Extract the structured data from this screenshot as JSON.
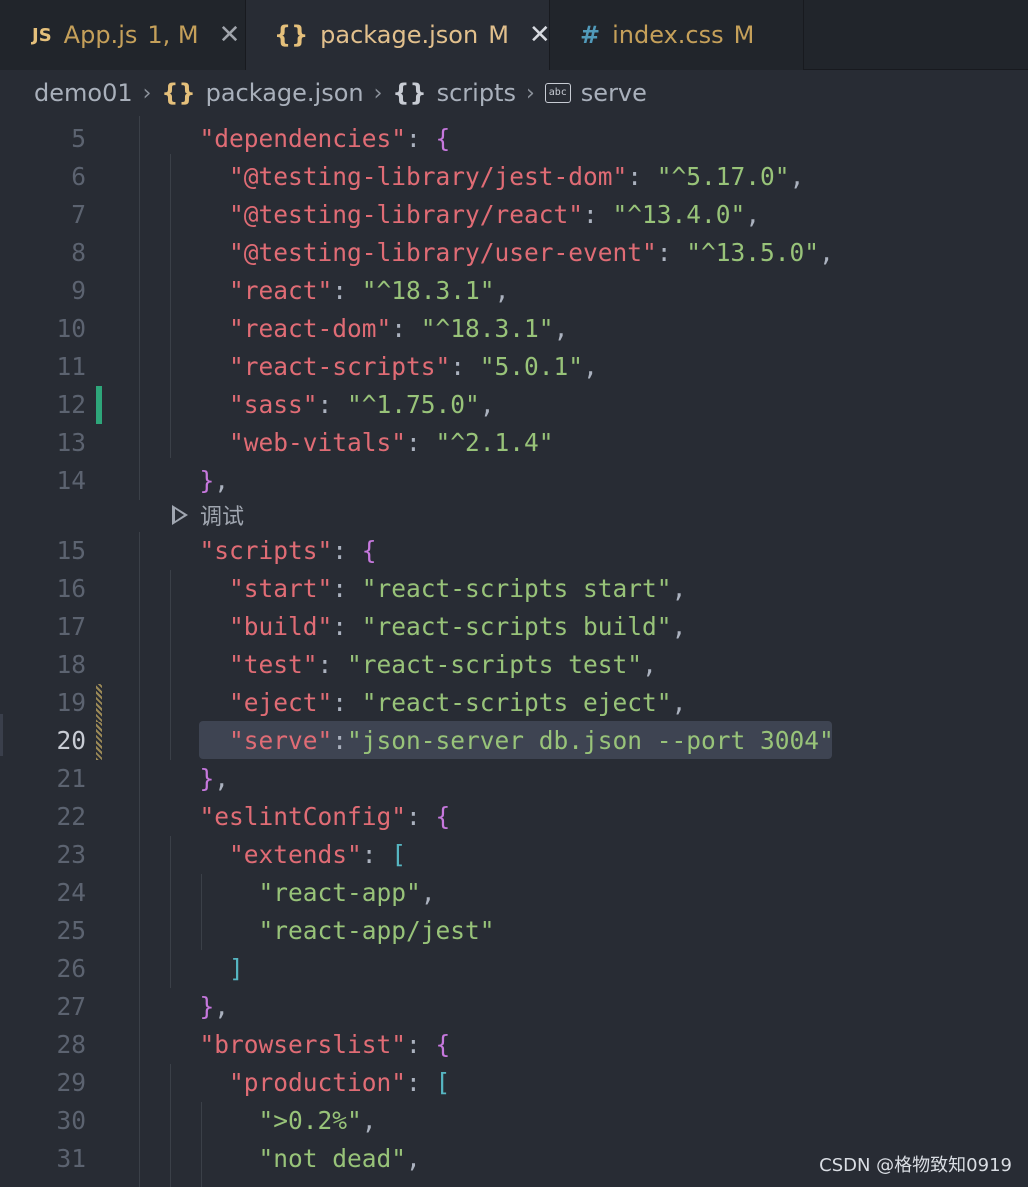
{
  "tabs": [
    {
      "icon": "JS",
      "label": "App.js",
      "badge": "1, M",
      "active": false
    },
    {
      "icon": "{}",
      "label": "package.json",
      "badge": "M",
      "active": true,
      "close": "✕"
    },
    {
      "icon": "#",
      "label": "index.css",
      "badge": "M",
      "active": false
    }
  ],
  "tab_close_inactive": "✕",
  "breadcrumb": {
    "folder": "demo01",
    "file_icon": "{}",
    "file": "package.json",
    "section_icon": "{}",
    "section": "scripts",
    "key": "serve"
  },
  "codelens": {
    "label": "调试"
  },
  "lines": [
    {
      "n": "5",
      "tokens": [
        {
          "t": "  ",
          "c": "p"
        },
        {
          "t": "\"dependencies\"",
          "c": "k"
        },
        {
          "t": ": ",
          "c": "p"
        },
        {
          "t": "{",
          "c": "bm"
        }
      ]
    },
    {
      "n": "6",
      "tokens": [
        {
          "t": "    ",
          "c": "p"
        },
        {
          "t": "\"@testing-library/jest-dom\"",
          "c": "k"
        },
        {
          "t": ": ",
          "c": "p"
        },
        {
          "t": "\"^5.17.0\"",
          "c": "s"
        },
        {
          "t": ",",
          "c": "p"
        }
      ]
    },
    {
      "n": "7",
      "tokens": [
        {
          "t": "    ",
          "c": "p"
        },
        {
          "t": "\"@testing-library/react\"",
          "c": "k"
        },
        {
          "t": ": ",
          "c": "p"
        },
        {
          "t": "\"^13.4.0\"",
          "c": "s"
        },
        {
          "t": ",",
          "c": "p"
        }
      ]
    },
    {
      "n": "8",
      "tokens": [
        {
          "t": "    ",
          "c": "p"
        },
        {
          "t": "\"@testing-library/user-event\"",
          "c": "k"
        },
        {
          "t": ": ",
          "c": "p"
        },
        {
          "t": "\"^13.5.0\"",
          "c": "s"
        },
        {
          "t": ",",
          "c": "p"
        }
      ]
    },
    {
      "n": "9",
      "tokens": [
        {
          "t": "    ",
          "c": "p"
        },
        {
          "t": "\"react\"",
          "c": "k"
        },
        {
          "t": ": ",
          "c": "p"
        },
        {
          "t": "\"^18.3.1\"",
          "c": "s"
        },
        {
          "t": ",",
          "c": "p"
        }
      ]
    },
    {
      "n": "10",
      "tokens": [
        {
          "t": "    ",
          "c": "p"
        },
        {
          "t": "\"react-dom\"",
          "c": "k"
        },
        {
          "t": ": ",
          "c": "p"
        },
        {
          "t": "\"^18.3.1\"",
          "c": "s"
        },
        {
          "t": ",",
          "c": "p"
        }
      ]
    },
    {
      "n": "11",
      "tokens": [
        {
          "t": "    ",
          "c": "p"
        },
        {
          "t": "\"react-scripts\"",
          "c": "k"
        },
        {
          "t": ": ",
          "c": "p"
        },
        {
          "t": "\"5.0.1\"",
          "c": "s"
        },
        {
          "t": ",",
          "c": "p"
        }
      ]
    },
    {
      "n": "12",
      "tokens": [
        {
          "t": "    ",
          "c": "p"
        },
        {
          "t": "\"sass\"",
          "c": "k"
        },
        {
          "t": ": ",
          "c": "p"
        },
        {
          "t": "\"^1.75.0\"",
          "c": "s"
        },
        {
          "t": ",",
          "c": "p"
        }
      ],
      "gutter": "added"
    },
    {
      "n": "13",
      "tokens": [
        {
          "t": "    ",
          "c": "p"
        },
        {
          "t": "\"web-vitals\"",
          "c": "k"
        },
        {
          "t": ": ",
          "c": "p"
        },
        {
          "t": "\"^2.1.4\"",
          "c": "s"
        }
      ]
    },
    {
      "n": "14",
      "tokens": [
        {
          "t": "  ",
          "c": "p"
        },
        {
          "t": "}",
          "c": "bm"
        },
        {
          "t": ",",
          "c": "p"
        }
      ]
    },
    {
      "n": "15",
      "tokens": [
        {
          "t": "  ",
          "c": "p"
        },
        {
          "t": "\"scripts\"",
          "c": "k"
        },
        {
          "t": ": ",
          "c": "p"
        },
        {
          "t": "{",
          "c": "bm"
        }
      ]
    },
    {
      "n": "16",
      "tokens": [
        {
          "t": "    ",
          "c": "p"
        },
        {
          "t": "\"start\"",
          "c": "k"
        },
        {
          "t": ": ",
          "c": "p"
        },
        {
          "t": "\"react-scripts start\"",
          "c": "s"
        },
        {
          "t": ",",
          "c": "p"
        }
      ]
    },
    {
      "n": "17",
      "tokens": [
        {
          "t": "    ",
          "c": "p"
        },
        {
          "t": "\"build\"",
          "c": "k"
        },
        {
          "t": ": ",
          "c": "p"
        },
        {
          "t": "\"react-scripts build\"",
          "c": "s"
        },
        {
          "t": ",",
          "c": "p"
        }
      ]
    },
    {
      "n": "18",
      "tokens": [
        {
          "t": "    ",
          "c": "p"
        },
        {
          "t": "\"test\"",
          "c": "k"
        },
        {
          "t": ": ",
          "c": "p"
        },
        {
          "t": "\"react-scripts test\"",
          "c": "s"
        },
        {
          "t": ",",
          "c": "p"
        }
      ]
    },
    {
      "n": "19",
      "tokens": [
        {
          "t": "    ",
          "c": "p"
        },
        {
          "t": "\"eject\"",
          "c": "k"
        },
        {
          "t": ": ",
          "c": "p"
        },
        {
          "t": "\"react-scripts eject\"",
          "c": "s"
        },
        {
          "t": ",",
          "c": "p"
        }
      ],
      "gutter": "modified"
    },
    {
      "n": "20",
      "tokens": [
        {
          "t": "    ",
          "c": "p"
        },
        {
          "t": "\"serve\"",
          "c": "k"
        },
        {
          "t": ":",
          "c": "p"
        },
        {
          "t": "\"json-server db.json --port 3004\"",
          "c": "s"
        }
      ],
      "gutter": "modified",
      "current": true
    },
    {
      "n": "21",
      "tokens": [
        {
          "t": "  ",
          "c": "p"
        },
        {
          "t": "}",
          "c": "bm"
        },
        {
          "t": ",",
          "c": "p"
        }
      ]
    },
    {
      "n": "22",
      "tokens": [
        {
          "t": "  ",
          "c": "p"
        },
        {
          "t": "\"eslintConfig\"",
          "c": "k"
        },
        {
          "t": ": ",
          "c": "p"
        },
        {
          "t": "{",
          "c": "bm"
        }
      ]
    },
    {
      "n": "23",
      "tokens": [
        {
          "t": "    ",
          "c": "p"
        },
        {
          "t": "\"extends\"",
          "c": "k"
        },
        {
          "t": ": ",
          "c": "p"
        },
        {
          "t": "[",
          "c": "bb"
        }
      ]
    },
    {
      "n": "24",
      "tokens": [
        {
          "t": "      ",
          "c": "p"
        },
        {
          "t": "\"react-app\"",
          "c": "s"
        },
        {
          "t": ",",
          "c": "p"
        }
      ]
    },
    {
      "n": "25",
      "tokens": [
        {
          "t": "      ",
          "c": "p"
        },
        {
          "t": "\"react-app/jest\"",
          "c": "s"
        }
      ]
    },
    {
      "n": "26",
      "tokens": [
        {
          "t": "    ",
          "c": "p"
        },
        {
          "t": "]",
          "c": "bb"
        }
      ]
    },
    {
      "n": "27",
      "tokens": [
        {
          "t": "  ",
          "c": "p"
        },
        {
          "t": "}",
          "c": "bm"
        },
        {
          "t": ",",
          "c": "p"
        }
      ]
    },
    {
      "n": "28",
      "tokens": [
        {
          "t": "  ",
          "c": "p"
        },
        {
          "t": "\"browserslist\"",
          "c": "k"
        },
        {
          "t": ": ",
          "c": "p"
        },
        {
          "t": "{",
          "c": "bm"
        }
      ]
    },
    {
      "n": "29",
      "tokens": [
        {
          "t": "    ",
          "c": "p"
        },
        {
          "t": "\"production\"",
          "c": "k"
        },
        {
          "t": ": ",
          "c": "p"
        },
        {
          "t": "[",
          "c": "bb"
        }
      ]
    },
    {
      "n": "30",
      "tokens": [
        {
          "t": "      ",
          "c": "p"
        },
        {
          "t": "\">0.2%\"",
          "c": "s"
        },
        {
          "t": ",",
          "c": "p"
        }
      ]
    },
    {
      "n": "31",
      "tokens": [
        {
          "t": "      ",
          "c": "p"
        },
        {
          "t": "\"not dead\"",
          "c": "s"
        },
        {
          "t": ",",
          "c": "p"
        }
      ]
    }
  ],
  "watermark": "CSDN @格物致知0919"
}
